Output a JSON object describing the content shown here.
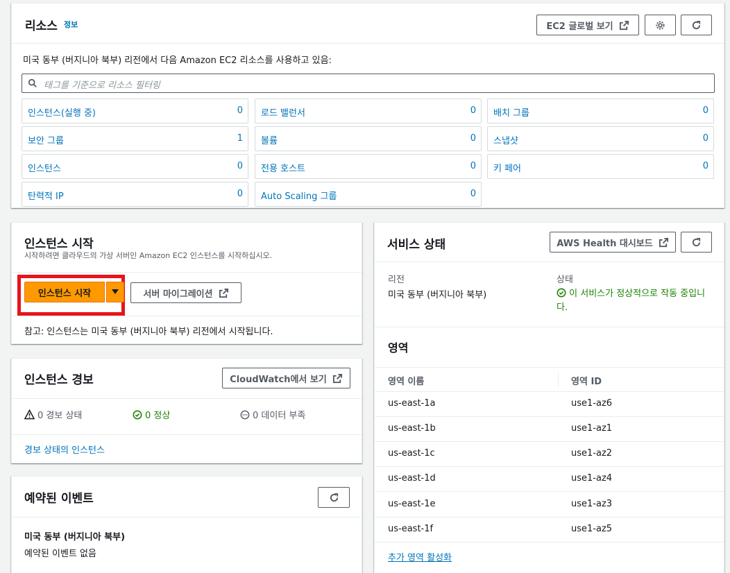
{
  "resources": {
    "title": "리소스",
    "info": "정보",
    "global_view_button": "EC2 글로벌 보기",
    "description": "미국 동부 (버지니아 북부) 리전에서 다음 Amazon EC2 리소스를 사용하고 있음:",
    "search_placeholder": "태그를 기준으로 리소스 필터링",
    "items": [
      {
        "label": "인스턴스(실행 중)",
        "count": "0"
      },
      {
        "label": "로드 밸런서",
        "count": "0"
      },
      {
        "label": "배치 그룹",
        "count": "0"
      },
      {
        "label": "보안 그룹",
        "count": "1"
      },
      {
        "label": "볼륨",
        "count": "0"
      },
      {
        "label": "스냅샷",
        "count": "0"
      },
      {
        "label": "인스턴스",
        "count": "0"
      },
      {
        "label": "전용 호스트",
        "count": "0"
      },
      {
        "label": "키 페어",
        "count": "0"
      },
      {
        "label": "탄력적 IP",
        "count": "0"
      },
      {
        "label": "Auto Scaling 그룹",
        "count": "0"
      }
    ]
  },
  "launch": {
    "title": "인스턴스 시작",
    "description": "시작하려면 클라우드의 가상 서버인 Amazon EC2 인스턴스를 시작하십시오.",
    "launch_button": "인스턴스 시작",
    "migrate_button": "서버 마이그레이션",
    "note": "참고: 인스턴스는 미국 동부 (버지니아 북부) 리전에서 시작됩니다.",
    "highlight_color": "#e8131b"
  },
  "alarms": {
    "title": "인스턴스 경보",
    "cloudwatch_button": "CloudWatch에서 보기",
    "alarm_state": "0 경보 상태",
    "ok_state": "0 정상",
    "insufficient": "0 데이터 부족",
    "alarm_link": "경보 상태의 인스턴스"
  },
  "events": {
    "title": "예약된 이벤트",
    "region": "미국 동부 (버지니아 북부)",
    "none": "예약된 이벤트 없음"
  },
  "health": {
    "title": "서비스 상태",
    "dashboard_button": "AWS Health 대시보드",
    "region_label": "리전",
    "region_value": "미국 동부 (버지니아 북부)",
    "status_label": "상태",
    "status_line1": "이 서비스가 정상적으로 작동 중입니",
    "status_line2": "다.",
    "status_color": "#1d8102"
  },
  "zones": {
    "title": "영역",
    "col_name": "영역 이름",
    "col_id": "영역 ID",
    "rows": [
      {
        "name": "us-east-1a",
        "id": "use1-az6"
      },
      {
        "name": "us-east-1b",
        "id": "use1-az1"
      },
      {
        "name": "us-east-1c",
        "id": "use1-az2"
      },
      {
        "name": "us-east-1d",
        "id": "use1-az4"
      },
      {
        "name": "us-east-1e",
        "id": "use1-az3"
      },
      {
        "name": "us-east-1f",
        "id": "use1-az5"
      }
    ],
    "enable_link": "추가 영역 활성화"
  },
  "colors": {
    "accent_orange": "#ff9900",
    "link_blue": "#0073bb"
  }
}
